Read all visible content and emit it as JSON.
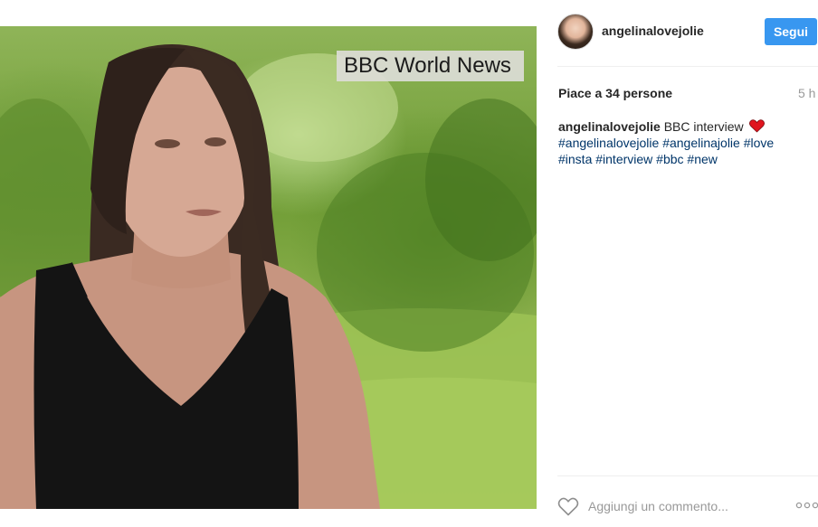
{
  "post": {
    "image_overlay_text": "BBC World News",
    "author": "angelinalovejolie",
    "follow_label": "Segui",
    "likes_text": "Piace a 34 persone",
    "time_ago": "5 h",
    "caption": {
      "user": "angelinalovejolie",
      "text": "BBC interview",
      "hashtags": [
        "#angelinalovejolie",
        "#angelinajolie",
        "#love",
        "#insta",
        "#interview",
        "#bbc",
        "#new"
      ]
    },
    "comment_placeholder": "Aggiungi un commento..."
  },
  "icons": {
    "like": "heart-outline-icon",
    "more": "more-options-icon",
    "emoji": "red-heart-emoji"
  },
  "colors": {
    "follow_button": "#3897f0",
    "hashtag": "#003569",
    "muted": "#999999"
  }
}
